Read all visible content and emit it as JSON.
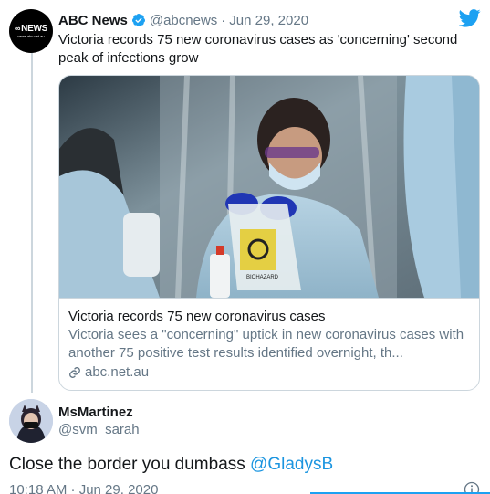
{
  "tweet": {
    "author_name": "ABC News",
    "author_handle": "@abcnews",
    "separator": "·",
    "date": "Jun 29, 2020",
    "text": "Victoria records 75 new coronavirus cases as 'concerning' second peak of infections grow",
    "avatar_logo": "NEWS",
    "avatar_sub": "news.abc.net.au",
    "icons": {
      "verified": "verified-badge-icon",
      "brand": "twitter-bird-icon"
    },
    "colors": {
      "verified": "#1da1f2",
      "brand": "#1da1f2"
    }
  },
  "card": {
    "title": "Victoria records 75 new coronavirus cases",
    "description": "Victoria sees a \"concerning\" uptick in new coronavirus cases with another 75 positive test results identified overnight, th...",
    "domain": "abc.net.au",
    "image_text": "BIOHAZARD",
    "link_icon": "link-icon"
  },
  "reply": {
    "author_name": "MsMartinez",
    "author_handle": "@svm_sarah",
    "text_plain": "Close the border you dumbass ",
    "mention": "@GladysB",
    "time": "10:18 AM · Jun 29, 2020",
    "info_icon": "info-icon",
    "colors": {
      "mention": "#1b95e0"
    }
  }
}
